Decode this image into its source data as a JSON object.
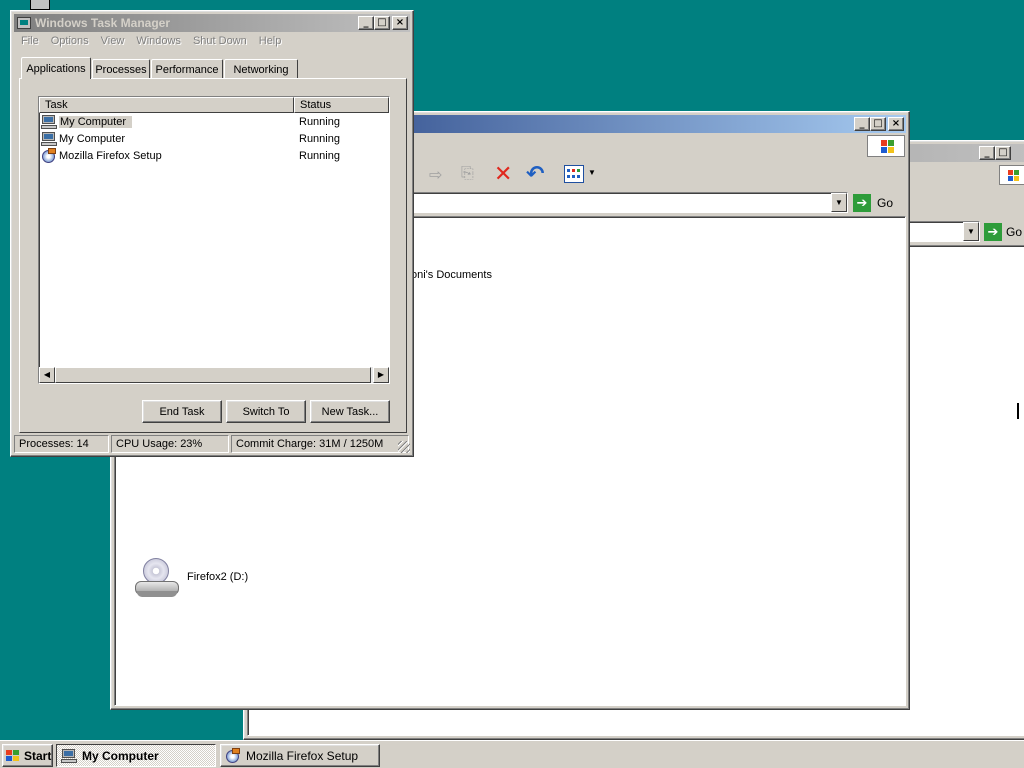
{
  "desktop": {
    "background": "#008080"
  },
  "back_window": {
    "go_label": "Go"
  },
  "explorer": {
    "go_label": "Go",
    "folder_item": "oni's Documents",
    "drive_item": "Firefox2 (D:)"
  },
  "taskmgr": {
    "title": "Windows Task Manager",
    "menu": [
      "File",
      "Options",
      "View",
      "Windows",
      "Shut Down",
      "Help"
    ],
    "tabs": [
      "Applications",
      "Processes",
      "Performance",
      "Networking"
    ],
    "columns": {
      "task": "Task",
      "status": "Status"
    },
    "rows": [
      {
        "task": "My Computer",
        "status": "Running",
        "selected": true
      },
      {
        "task": "My Computer",
        "status": "Running",
        "selected": false
      },
      {
        "task": "Mozilla Firefox Setup",
        "status": "Running",
        "selected": false
      }
    ],
    "buttons": {
      "end_task": "End Task",
      "switch_to": "Switch To",
      "new_task": "New Task..."
    },
    "status": {
      "processes": "Processes: 14",
      "cpu": "CPU Usage: 23%",
      "commit": "Commit Charge: 31M / 1250M"
    }
  },
  "taskbar": {
    "start": "Start",
    "items": [
      "My Computer",
      "Mozilla Firefox Setup"
    ]
  }
}
